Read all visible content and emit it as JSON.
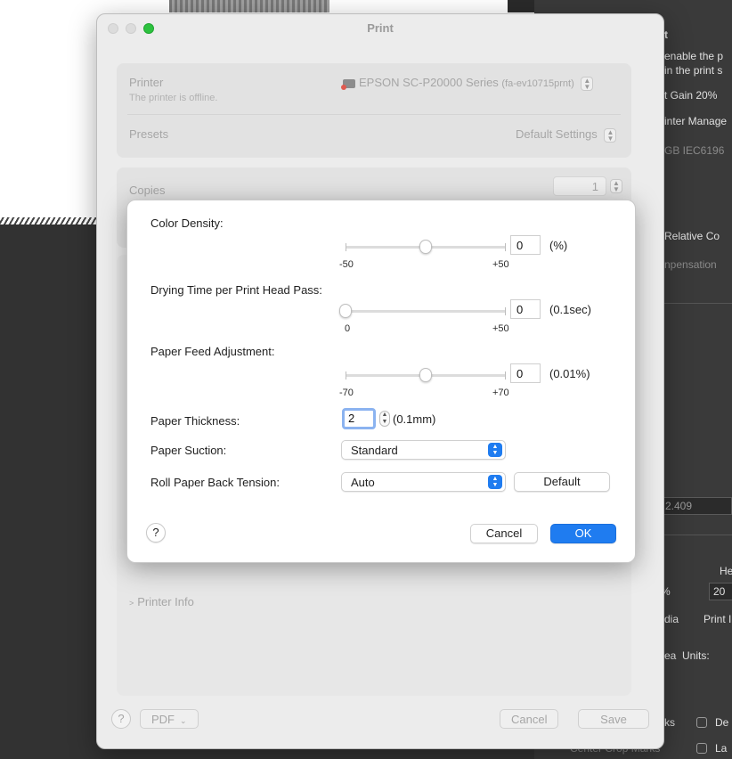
{
  "background": {
    "panel_lines": [
      {
        "text": "t",
        "bold": true
      },
      {
        "text": "enable the p"
      },
      {
        "text": "in the print s"
      },
      {
        "text": "t Gain 20%"
      },
      {
        "text": "inter Manage"
      },
      {
        "text": "GB IEC6196",
        "dim": true
      },
      {
        "text": "Relative Co"
      },
      {
        "text": "npensation",
        "dim": true
      }
    ],
    "field_value": "2.409",
    "he_label": "He",
    "pct_label": "%",
    "twenty": "20",
    "dia": "dia",
    "print_i": "Print I",
    "units_label": "Units:",
    "ea": "ea",
    "ks": "ks",
    "de": "De",
    "center_crop_marks": "Center Crop Marks",
    "la": "La"
  },
  "window": {
    "title": "Print",
    "printer_label": "Printer",
    "printer_status": "The printer is offline.",
    "printer_name": "EPSON SC-P20000 Series",
    "printer_id": "(fa-ev10715prnt)",
    "presets_label": "Presets",
    "presets_value": "Default Settings",
    "copies_label": "Copies",
    "copies_value": "1",
    "printer_info": "Printer Info",
    "help": "?",
    "pdf": "PDF",
    "cancel": "Cancel",
    "save": "Save"
  },
  "sheet": {
    "color_density": {
      "label": "Color Density:",
      "value": "0",
      "unit": "(%)",
      "min": "-50",
      "max": "+50",
      "min_val": -50,
      "max_val": 50,
      "cur": 0
    },
    "drying_time": {
      "label": "Drying Time per Print Head Pass:",
      "value": "0",
      "unit": "(0.1sec)",
      "min": "0",
      "max": "+50",
      "min_val": 0,
      "max_val": 50,
      "cur": 0
    },
    "paper_feed": {
      "label": "Paper Feed Adjustment:",
      "value": "0",
      "unit": "(0.01%)",
      "min": "-70",
      "max": "+70",
      "min_val": -70,
      "max_val": 70,
      "cur": 0
    },
    "paper_thickness": {
      "label": "Paper Thickness:",
      "value": "2",
      "unit": "(0.1mm)"
    },
    "paper_suction": {
      "label": "Paper Suction:",
      "value": "Standard"
    },
    "roll_tension": {
      "label": "Roll Paper Back Tension:",
      "value": "Auto"
    },
    "default_button": "Default",
    "help": "?",
    "cancel": "Cancel",
    "ok": "OK"
  }
}
